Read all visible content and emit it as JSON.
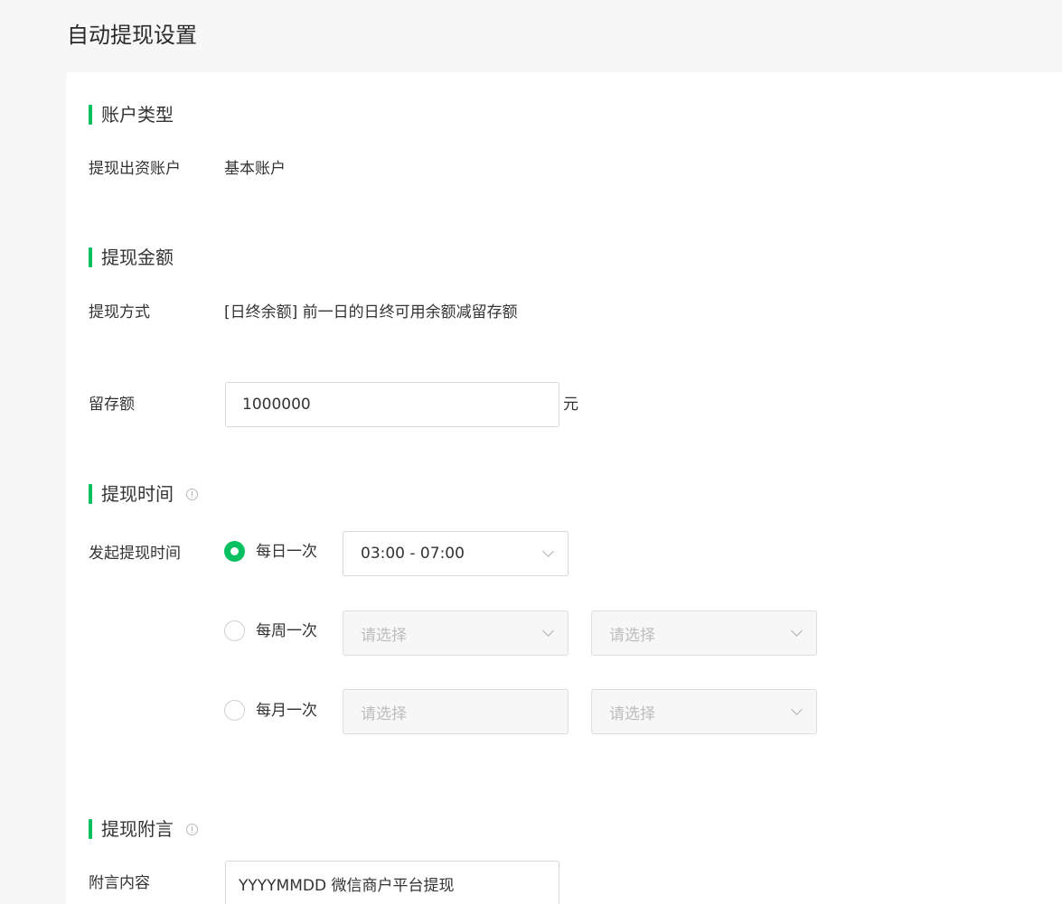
{
  "page": {
    "title": "自动提现设置"
  },
  "account_section": {
    "title": "账户类型",
    "source_account_label": "提现出资账户",
    "source_account_value": "基本账户"
  },
  "amount_section": {
    "title": "提现金额",
    "method_label": "提现方式",
    "method_value": "[日终余额] 前一日的日终可用余额减留存额",
    "reserve_label": "留存额",
    "reserve_value": "1000000",
    "reserve_unit": "元"
  },
  "time_section": {
    "title": "提现时间",
    "info_icon": "info-circle-icon",
    "start_time_label": "发起提现时间",
    "options": [
      {
        "label": "每日一次",
        "checked": true,
        "select_1": "03:00 - 07:00"
      },
      {
        "label": "每周一次",
        "checked": false,
        "select_1": "请选择",
        "select_2": "请选择"
      },
      {
        "label": "每月一次",
        "checked": false,
        "select_1": "请选择",
        "select_2": "请选择"
      }
    ]
  },
  "remark_section": {
    "title": "提现附言",
    "info_icon": "info-circle-icon",
    "content_label": "附言内容",
    "content_value": "YYYYMMDD 微信商户平台提现"
  },
  "colors": {
    "accent": "#07c160",
    "page_bg": "#f7f7f7",
    "card_bg": "#ffffff",
    "border": "#d8d8d8",
    "placeholder": "#bdbdbd"
  }
}
